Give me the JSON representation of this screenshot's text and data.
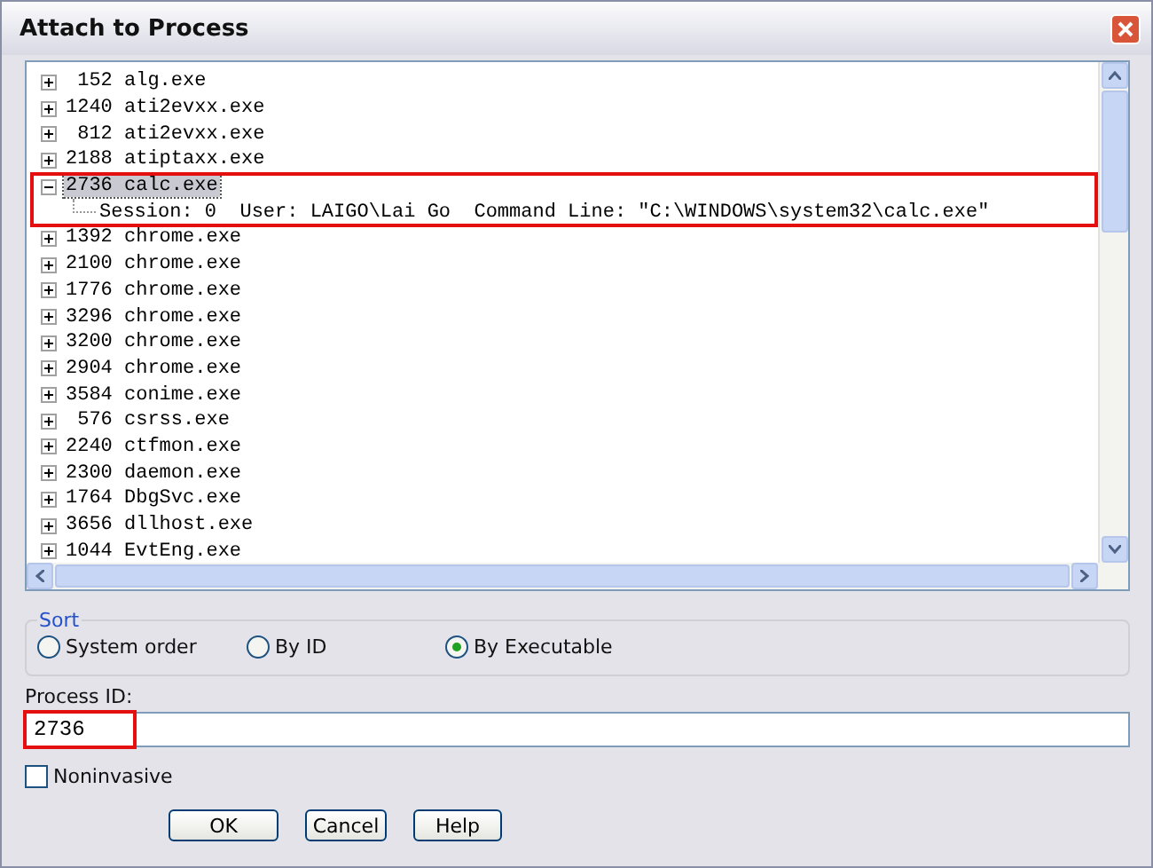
{
  "window": {
    "title": "Attach to Process"
  },
  "processes": [
    {
      "pid": "152",
      "name": "alg.exe",
      "expanded": false,
      "selected": false
    },
    {
      "pid": "1240",
      "name": "ati2evxx.exe",
      "expanded": false,
      "selected": false
    },
    {
      "pid": "812",
      "name": "ati2evxx.exe",
      "expanded": false,
      "selected": false
    },
    {
      "pid": "2188",
      "name": "atiptaxx.exe",
      "expanded": false,
      "selected": false
    },
    {
      "pid": "2736",
      "name": "calc.exe",
      "expanded": true,
      "selected": true,
      "highlighted": true,
      "children": [
        {
          "text": "Session: 0  User: LAIGO\\Lai Go  Command Line: \"C:\\WINDOWS\\system32\\calc.exe\""
        }
      ]
    },
    {
      "pid": "1392",
      "name": "chrome.exe",
      "expanded": false,
      "selected": false
    },
    {
      "pid": "2100",
      "name": "chrome.exe",
      "expanded": false,
      "selected": false
    },
    {
      "pid": "1776",
      "name": "chrome.exe",
      "expanded": false,
      "selected": false
    },
    {
      "pid": "3296",
      "name": "chrome.exe",
      "expanded": false,
      "selected": false
    },
    {
      "pid": "3200",
      "name": "chrome.exe",
      "expanded": false,
      "selected": false
    },
    {
      "pid": "2904",
      "name": "chrome.exe",
      "expanded": false,
      "selected": false
    },
    {
      "pid": "3584",
      "name": "conime.exe",
      "expanded": false,
      "selected": false
    },
    {
      "pid": "576",
      "name": "csrss.exe",
      "expanded": false,
      "selected": false
    },
    {
      "pid": "2240",
      "name": "ctfmon.exe",
      "expanded": false,
      "selected": false
    },
    {
      "pid": "2300",
      "name": "daemon.exe",
      "expanded": false,
      "selected": false
    },
    {
      "pid": "1764",
      "name": "DbgSvc.exe",
      "expanded": false,
      "selected": false
    },
    {
      "pid": "3656",
      "name": "dllhost.exe",
      "expanded": false,
      "selected": false
    },
    {
      "pid": "1044",
      "name": "EvtEng.exe",
      "expanded": false,
      "selected": false
    }
  ],
  "sort": {
    "title": "Sort",
    "options": [
      {
        "label": "System order",
        "selected": false
      },
      {
        "label": "By ID",
        "selected": false
      },
      {
        "label": "By Executable",
        "selected": true
      }
    ]
  },
  "process_id": {
    "label": "Process ID:",
    "value": "2736",
    "highlighted": true
  },
  "noninvasive": {
    "label": "Noninvasive",
    "checked": false
  },
  "buttons": [
    "OK",
    "Cancel",
    "Help"
  ]
}
